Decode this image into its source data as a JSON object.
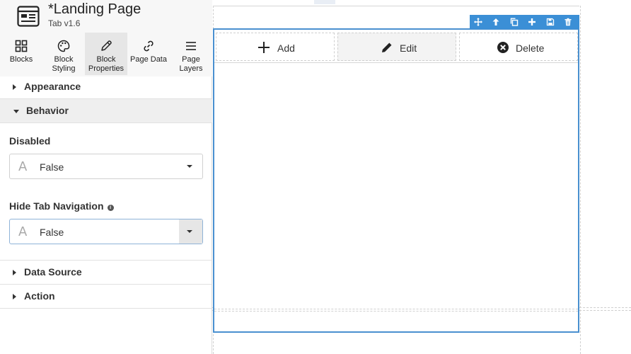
{
  "header": {
    "title": "*Landing Page",
    "subtitle": "Tab v1.6"
  },
  "tabs": [
    {
      "label": "Blocks",
      "icon": "grid-icon"
    },
    {
      "label": "Block Styling",
      "line1": "Block",
      "line2": "Styling",
      "icon": "palette-icon"
    },
    {
      "label": "Block Properties",
      "line1": "Block",
      "line2": "Properties",
      "icon": "pencil-icon",
      "active": true
    },
    {
      "label": "Page Data",
      "icon": "link-icon"
    },
    {
      "label": "Page Layers",
      "line1": "Page",
      "line2": "Layers",
      "icon": "menu-icon"
    }
  ],
  "sections": {
    "appearance": "Appearance",
    "behavior": "Behavior",
    "data_source": "Data Source",
    "action": "Action"
  },
  "behavior": {
    "disabled_label": "Disabled",
    "disabled_value": "False",
    "hide_nav_label": "Hide Tab Navigation",
    "hide_nav_value": "False",
    "text_type_glyph": "A"
  },
  "canvas": {
    "buttons": {
      "add": "Add",
      "edit": "Edit",
      "delete": "Delete"
    },
    "toolbar_icons": [
      "move-icon",
      "arrow-up-icon",
      "copy-icon",
      "plus-icon",
      "save-icon",
      "trash-icon"
    ]
  },
  "colors": {
    "accent": "#3b8fd6",
    "selection_border": "#4a90d0",
    "panel_header": "#f7f7f7",
    "active_tab": "#e6e6e6"
  }
}
